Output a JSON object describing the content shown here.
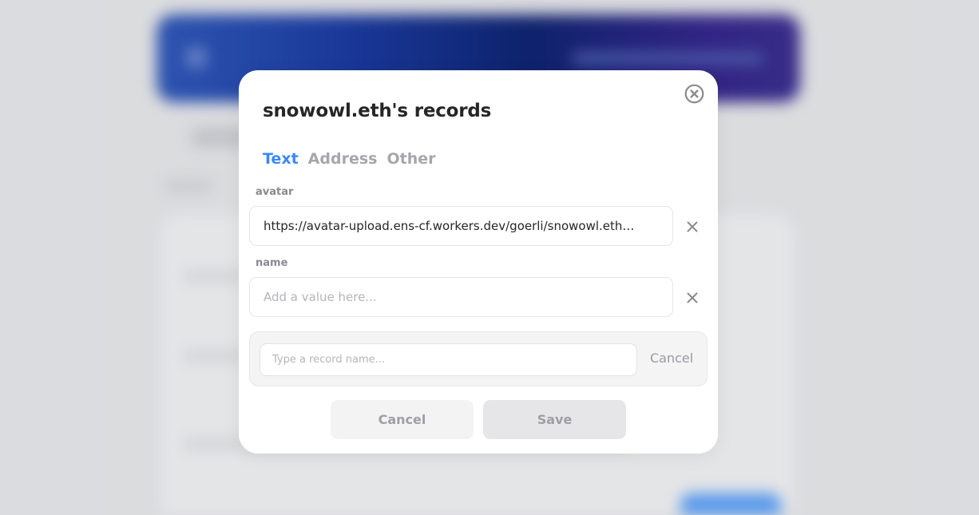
{
  "modal": {
    "title": "snowowl.eth's records",
    "close_icon": "close-circle-icon",
    "tabs": [
      {
        "label": "Text",
        "active": true
      },
      {
        "label": "Address",
        "active": false
      },
      {
        "label": "Other",
        "active": false
      }
    ],
    "fields": [
      {
        "label": "avatar",
        "value": "https://avatar-upload.ens-cf.workers.dev/goerli/snowowl.eth?ti…",
        "placeholder": "",
        "clear_icon": "close-x-icon"
      },
      {
        "label": "name",
        "value": "",
        "placeholder": "Add a value here...",
        "clear_icon": "close-x-icon"
      }
    ],
    "add_record": {
      "placeholder": "Type a record name...",
      "cancel_label": "Cancel"
    },
    "footer": {
      "cancel_label": "Cancel",
      "save_label": "Save"
    }
  },
  "colors": {
    "accent": "#3889ff",
    "muted_text": "#a6a6ad",
    "title_text": "#262626",
    "banner_gradient_start": "#2f58b8",
    "banner_gradient_end": "#3a2f8e"
  }
}
